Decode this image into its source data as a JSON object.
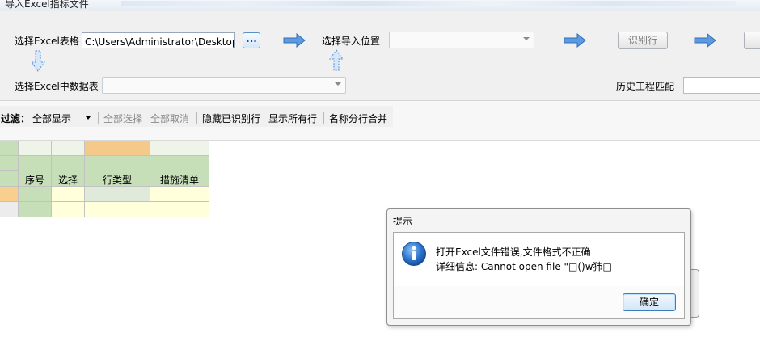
{
  "window": {
    "title": "导入Excel指标文件"
  },
  "import_panel": {
    "excel_file_label": "选择Excel表格",
    "excel_file_value": "C:\\Users\\Administrator\\Desktop\\山东",
    "browse_label": "...",
    "import_position_label": "选择导入位置",
    "import_position_value": "",
    "identify_button": "识别行",
    "sheet_label": "选择Excel中数据表",
    "sheet_value": "",
    "history_match_label": "历史工程匹配",
    "history_match_value": "",
    "colors": {
      "arrow": "#4f8fd8",
      "browse_border": "#5a8fc7"
    }
  },
  "filter_bar": {
    "filter_label": "过滤：",
    "filter_value": "全部显示",
    "select_all": "全部选择",
    "deselect_all": "全部取消",
    "hide_identified": "隐藏已识别行",
    "show_all_rows": "显示所有行",
    "merge_names": "名称分行合并"
  },
  "grid": {
    "headers": [
      "序号",
      "选择",
      "行类型",
      "措施清单"
    ],
    "rows": [
      [
        "",
        "",
        "",
        ""
      ],
      [
        "",
        "",
        "",
        ""
      ]
    ],
    "colors": {
      "header_green": "#c6dfb8",
      "header_selected": "#f5c98a",
      "row_cell": "#ffffdc",
      "row_header": "#f8e3b1"
    }
  },
  "dialog": {
    "title": "提示",
    "message_line1": "打开Excel文件错误,文件格式不正确",
    "message_line2": "详细信息: Cannot open file \"□()w犻□",
    "ok_button": "确定",
    "icon": "info-icon"
  }
}
